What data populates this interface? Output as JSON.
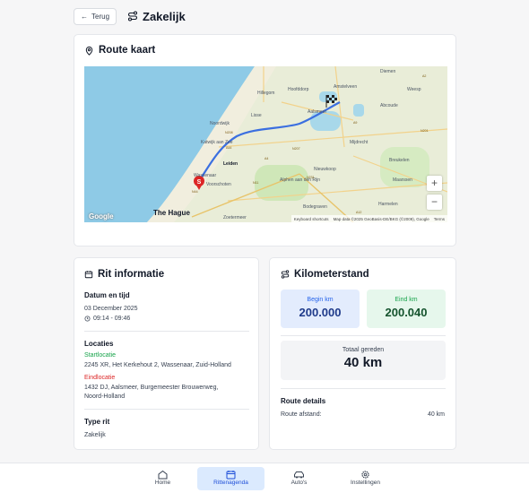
{
  "header": {
    "back_label": "Terug",
    "title": "Zakelijk"
  },
  "map_card": {
    "title": "Route kaart",
    "places": {
      "diemen": "Diemen",
      "amstelveen": "Amstelveen",
      "weesp": "Weesp",
      "hillegom": "Hillegom",
      "hoofddorp": "Hoofddorp",
      "lisse": "Lisse",
      "aalsmeer": "Aalsmeer",
      "abcoude": "Abcoude",
      "noordwijk": "Noordwijk",
      "katwijk": "Katwijk\naan Zee",
      "mijdrecht": "Mijdrecht",
      "leiden": "Leiden",
      "nieuwkoop": "Nieuwkoop",
      "breukelen": "Breukelen",
      "wassenaar": "Wassenaar",
      "voorschoten": "Voorschoten",
      "alphen": "Alphen aan\nden Rijn",
      "maarssen": "Maarssen",
      "the_hague": "The Hague",
      "zoetermeer": "Zoetermeer",
      "bodegraven": "Bodegraven",
      "harmelen": "Harmelen"
    },
    "roads": {
      "a9": "A9",
      "a4": "A4",
      "n201": "N201",
      "n207": "N207",
      "n231": "N231",
      "n11": "N11",
      "a12": "A12",
      "n44": "N44",
      "a44": "A44",
      "a2": "A2",
      "n208": "N208"
    },
    "zoom_in": "+",
    "zoom_out": "−",
    "google": "Google",
    "footer": {
      "shortcuts": "Keyboard shortcuts",
      "data": "Map data ©2025 GeoBasis-DE/BKG (©2009), Google",
      "terms": "Terms"
    },
    "start_marker": "S"
  },
  "info": {
    "title": "Rit informatie",
    "datetime_title": "Datum en tijd",
    "date": "03 December 2025",
    "time": "09:14 - 09:46",
    "locations_title": "Locaties",
    "start_label": "Startlocatie",
    "start_address": "2245 XR, Het Kerkehout 2, Wassenaar, Zuid-Holland",
    "end_label": "Eindlocatie",
    "end_address_1": "1432 DJ, Aalsmeer, Burgemeester Brouwerweg,",
    "end_address_2": "Noord-Holland",
    "type_title": "Type rit",
    "type_value": "Zakelijk"
  },
  "km": {
    "title": "Kilometerstand",
    "begin_label": "Begin km",
    "begin_value": "200.000",
    "end_label": "Eind km",
    "end_value": "200.040",
    "total_label": "Totaal gereden",
    "total_value": "40 km",
    "route_title": "Route details",
    "distance_label": "Route afstand:",
    "distance_value": "40 km"
  },
  "nav": {
    "items": [
      {
        "label": "Home",
        "icon": "home-icon"
      },
      {
        "label": "Rittenagenda",
        "icon": "calendar-icon"
      },
      {
        "label": "Auto's",
        "icon": "car-icon"
      },
      {
        "label": "Instellingen",
        "icon": "gear-icon"
      }
    ],
    "active": "Rittenagenda"
  },
  "colors": {
    "accent": "#1d4ed8",
    "route": "#3b6fe0",
    "start_pin": "#dc2626",
    "sea": "#8ecae6"
  }
}
